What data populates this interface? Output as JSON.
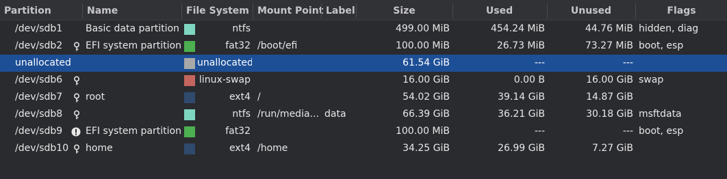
{
  "columns": {
    "partition": "Partition",
    "name": "Name",
    "filesystem": "File System",
    "mountpoint": "Mount Point",
    "label": "Label",
    "size": "Size",
    "used": "Used",
    "unused": "Unused",
    "flags": "Flags"
  },
  "rows": [
    {
      "partition": "/dev/sdb1",
      "icon": "",
      "name": "Basic data partition",
      "fs_color": "#7ed6c0",
      "filesystem": "ntfs",
      "mountpoint": "",
      "label": "",
      "size": "499.00 MiB",
      "used": "454.24 MiB",
      "unused": "44.76 MiB",
      "flags": "hidden, diag"
    },
    {
      "partition": "/dev/sdb2",
      "icon": "key-icon",
      "name": "EFI system partition",
      "fs_color": "#4caf50",
      "filesystem": "fat32",
      "mountpoint": "/boot/efi",
      "label": "",
      "size": "100.00 MiB",
      "used": "26.73 MiB",
      "unused": "73.27 MiB",
      "flags": "boot, esp"
    },
    {
      "partition": "unallocated",
      "icon": "",
      "name": "",
      "fs_color": "#a8a8a8",
      "filesystem": "unallocated",
      "mountpoint": "",
      "label": "",
      "size": "61.54 GiB",
      "used": "---",
      "unused": "---",
      "flags": ""
    },
    {
      "partition": "/dev/sdb6",
      "icon": "key-icon",
      "name": "",
      "fs_color": "#c4665e",
      "filesystem": "linux-swap",
      "mountpoint": "",
      "label": "",
      "size": "16.00 GiB",
      "used": "0.00 B",
      "unused": "16.00 GiB",
      "flags": "swap"
    },
    {
      "partition": "/dev/sdb7",
      "icon": "key-icon",
      "name": "root",
      "fs_color": "#2f4a6d",
      "filesystem": "ext4",
      "mountpoint": "/",
      "label": "",
      "size": "54.02 GiB",
      "used": "39.14 GiB",
      "unused": "14.87 GiB",
      "flags": ""
    },
    {
      "partition": "/dev/sdb8",
      "icon": "key-icon",
      "name": "",
      "fs_color": "#7ed6c0",
      "filesystem": "ntfs",
      "mountpoint": "/run/media...",
      "label": "data",
      "size": "66.39 GiB",
      "used": "36.21 GiB",
      "unused": "30.18 GiB",
      "flags": "msftdata"
    },
    {
      "partition": "/dev/sdb9",
      "icon": "warning-icon",
      "name": "EFI system partition",
      "fs_color": "#4caf50",
      "filesystem": "fat32",
      "mountpoint": "",
      "label": "",
      "size": "100.00 MiB",
      "used": "---",
      "unused": "---",
      "flags": "boot, esp"
    },
    {
      "partition": "/dev/sdb10",
      "icon": "key-icon",
      "name": "home",
      "fs_color": "#2f4a6d",
      "filesystem": "ext4",
      "mountpoint": "/home",
      "label": "",
      "size": "34.25 GiB",
      "used": "26.99 GiB",
      "unused": "7.27 GiB",
      "flags": ""
    }
  ],
  "selected_row": 2
}
